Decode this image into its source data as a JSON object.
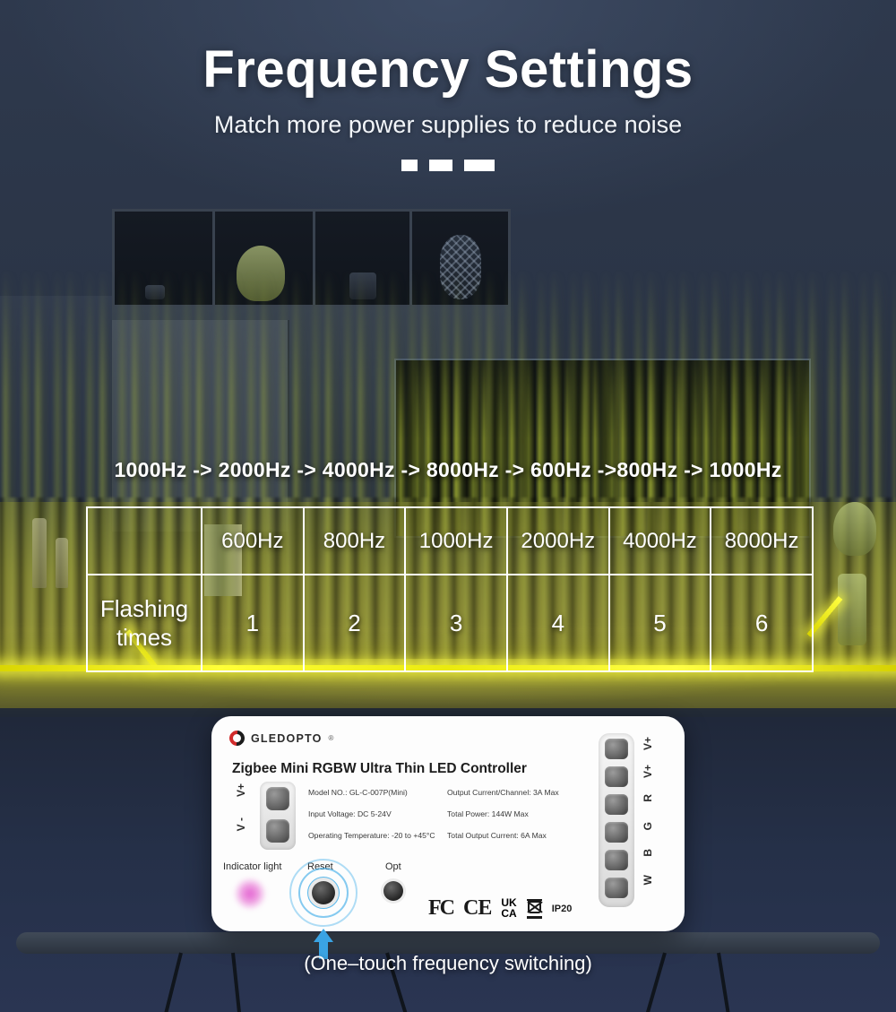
{
  "header": {
    "title": "Frequency Settings",
    "subtitle": "Match more power supplies to reduce noise",
    "dash_widths": [
      18,
      26,
      34
    ]
  },
  "sequence": {
    "text": "1000Hz -> 2000Hz -> 4000Hz -> 8000Hz -> 600Hz ->800Hz -> 1000Hz"
  },
  "table": {
    "header_row": [
      "",
      "600Hz",
      "800Hz",
      "1000Hz",
      "2000Hz",
      "4000Hz",
      "8000Hz"
    ],
    "body_row_label": "Flashing\ntimes",
    "body_row_label_line1": "Flashing",
    "body_row_label_line2": "times",
    "body_values": [
      "1",
      "2",
      "3",
      "4",
      "5",
      "6"
    ]
  },
  "device": {
    "brand": "GLEDOPTO",
    "brand_registered": "®",
    "product_title": "Zigbee Mini RGBW Ultra Thin LED Controller",
    "specs_left": [
      "Model NO.: GL-C-007P(Mini)",
      "Input Voltage: DC 5-24V",
      "Operating Temperature: -20 to +45°C"
    ],
    "specs_right": [
      "Output Current/Channel: 3A Max",
      "Total Power: 144W Max",
      "Total Output Current: 6A Max"
    ],
    "input_terminals": [
      "V+",
      "V -"
    ],
    "output_terminals": [
      "V+",
      "V+",
      "R",
      "G",
      "B",
      "W"
    ],
    "controls": {
      "indicator_label": "Indicator light",
      "reset_label": "Reset",
      "opt_label": "Opt"
    },
    "certifications": {
      "fcc": "FC",
      "ce": "CE",
      "ukca_line1": "UK",
      "ukca_line2": "CA",
      "weee": "weee-bin-icon",
      "ip_rating": "IP20"
    }
  },
  "caption": "(One–touch frequency switching)",
  "colors": {
    "background": "#2b3547",
    "led_strip": "#ffff38",
    "accent_blue": "#3aa3e3",
    "indicator_pink": "#e25fd0",
    "text_white": "#ffffff",
    "brand_red": "#d12b2b"
  }
}
